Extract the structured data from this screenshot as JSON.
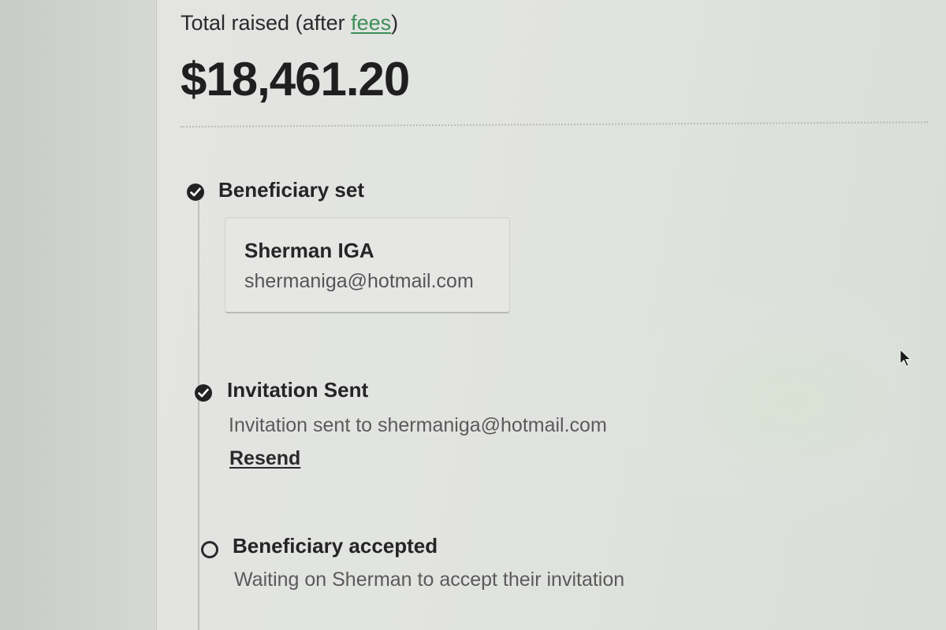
{
  "summary": {
    "total_label_prefix": "Total raised (after ",
    "fees_link": "fees",
    "total_label_suffix": ")",
    "total_amount": "$18,461.20"
  },
  "timeline": {
    "steps": [
      {
        "title": "Beneficiary set",
        "status": "complete",
        "beneficiary_name": "Sherman IGA",
        "beneficiary_email": "shermaniga@hotmail.com"
      },
      {
        "title": "Invitation Sent",
        "status": "complete",
        "description": "Invitation sent to shermaniga@hotmail.com",
        "action_label": "Resend"
      },
      {
        "title": "Beneficiary accepted",
        "status": "pending",
        "description": "Waiting on Sherman to accept their invitation"
      }
    ]
  },
  "colors": {
    "link_green": "#3e8e58",
    "text_dark": "#232323",
    "text_muted": "#5a5a5a"
  },
  "icons": {
    "complete": "check-circle-icon",
    "pending": "empty-circle-icon",
    "pointer": "mouse-cursor-icon"
  }
}
